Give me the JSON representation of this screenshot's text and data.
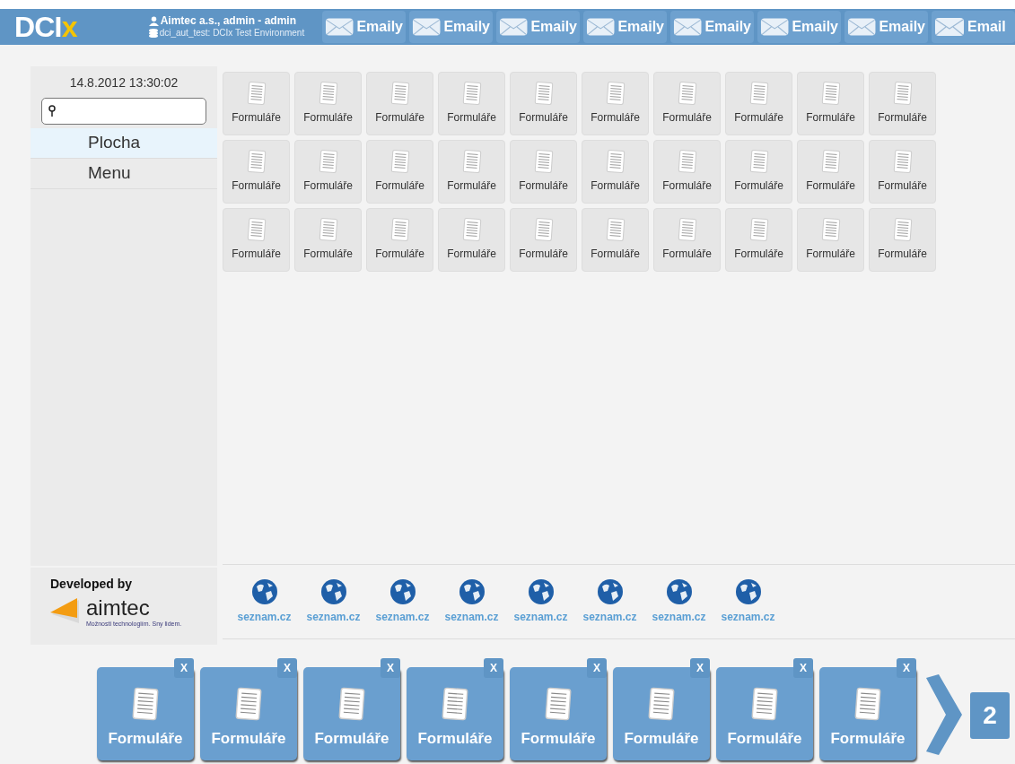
{
  "header": {
    "logo": {
      "main": "DCI",
      "accent": "x"
    },
    "user": "Aimtec a.s., admin - admin",
    "environment": "dci_aut_test: DCIx Test Environment",
    "tabs": [
      "Emaily",
      "Emaily",
      "Emaily",
      "Emaily",
      "Emaily",
      "Emaily",
      "Emaily",
      "Email"
    ]
  },
  "sidebar": {
    "datetime": "14.8.2012 13:30:02",
    "items": [
      {
        "label": "Plocha",
        "selected": true
      },
      {
        "label": "Menu",
        "selected": false
      }
    ],
    "developed_by": "Developed by",
    "brand": "aimtec",
    "slogan": "Možnosti technologiím. Sny lidem."
  },
  "desktop": {
    "rows": [
      [
        "Formuláře",
        "Formuláře",
        "Formuláře",
        "Formuláře",
        "Formuláře",
        "Formuláře",
        "Formuláře",
        "Formuláře",
        "Formuláře",
        "Formuláře"
      ],
      [
        "Formuláře",
        "Formuláře",
        "Formuláře",
        "Formuláře",
        "Formuláře",
        "Formuláře",
        "Formuláře",
        "Formuláře",
        "Formuláře",
        "Formuláře"
      ],
      [
        "Formuláře",
        "Formuláře",
        "Formuláře",
        "Formuláře",
        "Formuláře",
        "Formuláře",
        "Formuláře",
        "Formuláře",
        "Formuláře",
        "Formuláře"
      ]
    ]
  },
  "links": [
    "seznam.cz",
    "seznam.cz",
    "seznam.cz",
    "seznam.cz",
    "seznam.cz",
    "seznam.cz",
    "seznam.cz",
    "seznam.cz"
  ],
  "taskbar": {
    "items": [
      {
        "label": "Formuláře",
        "close": "X"
      },
      {
        "label": "Formuláře",
        "close": "X"
      },
      {
        "label": "Formuláře",
        "close": "X"
      },
      {
        "label": "Formuláře",
        "close": "X"
      },
      {
        "label": "Formuláře",
        "close": "X"
      },
      {
        "label": "Formuláře",
        "close": "X"
      },
      {
        "label": "Formuláře",
        "close": "X"
      },
      {
        "label": "Formuláře",
        "close": "X"
      }
    ],
    "page": "2"
  }
}
